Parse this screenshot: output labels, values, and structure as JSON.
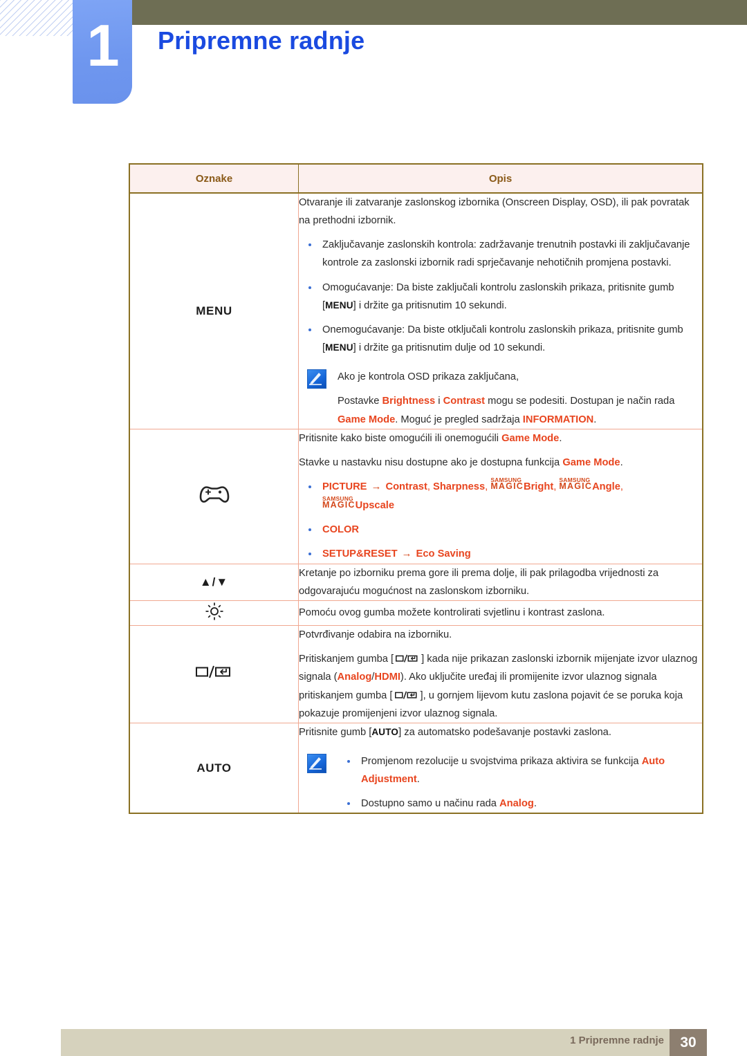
{
  "header": {
    "chapter_number": "1",
    "chapter_title": "Pripremne radnje"
  },
  "table": {
    "columns": [
      "Oznake",
      "Opis"
    ],
    "rows": [
      {
        "symbol": "MENU",
        "symbol_icon": "menu-text",
        "paragraphs": [
          "Otvaranje ili zatvaranje zaslonskog izbornika (Onscreen Display, OSD), ili pak povratak na prethodni izbornik."
        ],
        "bullets": [
          "Zaključavanje zaslonskih kontrola: zadržavanje trenutnih postavki ili zaključavanje kontrole za zaslonski izbornik radi sprječavanje nehotičnih promjena postavki.",
          "Omogućavanje: Da biste zaključali kontrolu zaslonskih prikaza, pritisnite gumb [MENU] i držite ga pritisnutim 10 sekundi.",
          "Onemogućavanje: Da biste otključali kontrolu zaslonskih prikaza, pritisnite gumb [MENU] i držite ga pritisnutim dulje od 10 sekundi."
        ],
        "note": {
          "line1": "Ako je kontrola OSD prikaza zaključana,",
          "line2_parts": [
            "Postavke ",
            "Brightness",
            " i ",
            "Contrast",
            " mogu se podesiti. Dostupan je način rada ",
            "Game Mode",
            ". Moguć je pregled sadržaja ",
            "INFORMATION",
            "."
          ]
        }
      },
      {
        "symbol": "",
        "symbol_icon": "gamepad-icon",
        "paragraphs": [
          "Pritisnite kako biste omogućili ili onemogućili Game Mode.",
          "Stavke u nastavku nisu dostupne ako je dostupna funkcija Game Mode."
        ],
        "menu_bullets": [
          "PICTURE → Contrast, Sharpness, SAMSUNG MAGIC Bright, SAMSUNG MAGIC Angle, SAMSUNG MAGIC Upscale",
          "COLOR",
          "SETUP&RESET → Eco Saving"
        ]
      },
      {
        "symbol": "▲/▼",
        "symbol_icon": "up-down-arrows-icon",
        "paragraphs": [
          "Kretanje po izborniku prema gore ili prema dolje, ili pak prilagodba vrijednosti za odgovarajuću mogućnost na zaslonskom izborniku."
        ]
      },
      {
        "symbol": "☼",
        "symbol_icon": "brightness-icon",
        "paragraphs": [
          "Pomoću ovog gumba možete kontrolirati svjetlinu i kontrast zaslona."
        ]
      },
      {
        "symbol": "⎚/⏎",
        "symbol_icon": "source-enter-icon",
        "paragraphs": [
          "Potvrđivanje odabira na izborniku.",
          "Pritiskanjem gumba [⎚/⏎] kada nije prikazan zaslonski izbornik mijenjate izvor ulaznog signala (Analog/HDMI). Ako uključite uređaj ili promijenite izvor ulaznog signala pritiskanjem gumba [⎚/⏎], u gornjem lijevom kutu zaslona pojavit će se poruka koja pokazuje promijenjeni izvor ulaznog signala."
        ]
      },
      {
        "symbol": "AUTO",
        "symbol_icon": "auto-text",
        "paragraphs": [
          "Pritisnite gumb [AUTO] za automatsko podešavanje postavki zaslona."
        ],
        "note_bullets": [
          "Promjenom rezolucije u svojstvima prikaza aktivira se funkcija Auto Adjustment.",
          "Dostupno samo u načinu rada Analog."
        ]
      }
    ]
  },
  "text_fragments": {
    "row1_p1": "Otvaranje ili zatvaranje zaslonskog izbornika (Onscreen Display, OSD), ili pak povratak na prethodni izbornik.",
    "row1_b1": "Zaključavanje zaslonskih kontrola: zadržavanje trenutnih postavki ili zaključavanje kontrole za zaslonski izbornik radi sprječavanje nehotičnih promjena postavki.",
    "row1_b2_a": "Omogućavanje: Da biste zaključali kontrolu zaslonskih prikaza, pritisnite gumb [",
    "row1_b2_key": "MENU",
    "row1_b2_b": "] i držite ga pritisnutim 10 sekundi.",
    "row1_b3_a": "Onemogućavanje: Da biste otključali kontrolu zaslonskih prikaza, pritisnite gumb [",
    "row1_b3_key": "MENU",
    "row1_b3_b": "] i držite ga pritisnutim dulje od 10 sekundi.",
    "row1_note1": "Ako je kontrola OSD prikaza zaključana,",
    "row1_note2_a": "Postavke ",
    "row1_note2_brightness": "Brightness",
    "row1_note2_b": " i ",
    "row1_note2_contrast": "Contrast",
    "row1_note2_c": " mogu se podesiti. Dostupan je način rada ",
    "row1_note2_gamemode": "Game Mode",
    "row1_note2_d": ". Moguć je pregled sadržaja ",
    "row1_note2_information": "INFORMATION",
    "row1_note2_e": ".",
    "row2_p1_a": "Pritisnite kako biste omogućili ili onemogućili ",
    "row2_p1_gm": "Game Mode",
    "row2_p1_b": ".",
    "row2_p2_a": "Stavke u nastavku nisu dostupne ako je dostupna funkcija ",
    "row2_p2_gm": "Game Mode",
    "row2_p2_b": ".",
    "row2_picture": "PICTURE",
    "row2_arrow": "→",
    "row2_contrast": "Contrast",
    "row2_comma1": ", ",
    "row2_sharpness": "Sharpness",
    "row2_comma2": ", ",
    "row2_bright": "Bright",
    "row2_comma3": ", ",
    "row2_angle": "Angle",
    "row2_comma4": ",",
    "row2_upscale": "Upscale",
    "row2_color": "COLOR",
    "row2_setupreset": "SETUP&RESET",
    "row2_arrow2": "→",
    "row2_ecosaving": "Eco Saving",
    "magic_top": "SAMSUNG",
    "magic_bottom": "MAGIC",
    "row3_p1": "Kretanje po izborniku prema gore ili prema dolje, ili pak prilagodba vrijednosti za odgovarajuću mogućnost na zaslonskom izborniku.",
    "row4_p1": "Pomoću ovog gumba možete kontrolirati svjetlinu i kontrast zaslona.",
    "row5_p1": "Potvrđivanje odabira na izborniku.",
    "row5_p2_a": "Pritiskanjem gumba [",
    "row5_p2_b": "] kada nije prikazan zaslonski izbornik mijenjate izvor ulaznog signala (",
    "row5_analog": "Analog",
    "row5_slash": "/",
    "row5_hdmi": "HDMI",
    "row5_p2_c": "). Ako uključite uređaj ili promijenite izvor ulaznog signala pritiskanjem gumba [",
    "row5_p2_d": "], u gornjem lijevom kutu zaslona pojavit će se poruka koja pokazuje promijenjeni izvor ulaznog signala.",
    "row6_p1_a": "Pritisnite gumb [",
    "row6_key": "AUTO",
    "row6_p1_b": "] za automatsko podešavanje postavki zaslona.",
    "row6_nb1_a": "Promjenom rezolucije u svojstvima prikaza aktivira se funkcija ",
    "row6_nb1_b": "Auto Adjustment",
    "row6_nb1_c": ".",
    "row6_nb2_a": "Dostupno samo u načinu rada ",
    "row6_nb2_b": "Analog",
    "row6_nb2_c": ".",
    "sym_menu": "MENU",
    "sym_updown": "▲/▼",
    "sym_auto": "AUTO"
  },
  "footer": {
    "text": "1 Pripremne radnje",
    "page": "30"
  },
  "colors": {
    "accent_orange": "#e8451f",
    "title_blue": "#1a4ae0",
    "olive": "#6e6e54",
    "table_border": "#8a7023",
    "cell_border": "#f0a891",
    "header_bg": "#fcf0ee",
    "footer_bg": "#d6d2bd",
    "page_box": "#8d7f70"
  }
}
